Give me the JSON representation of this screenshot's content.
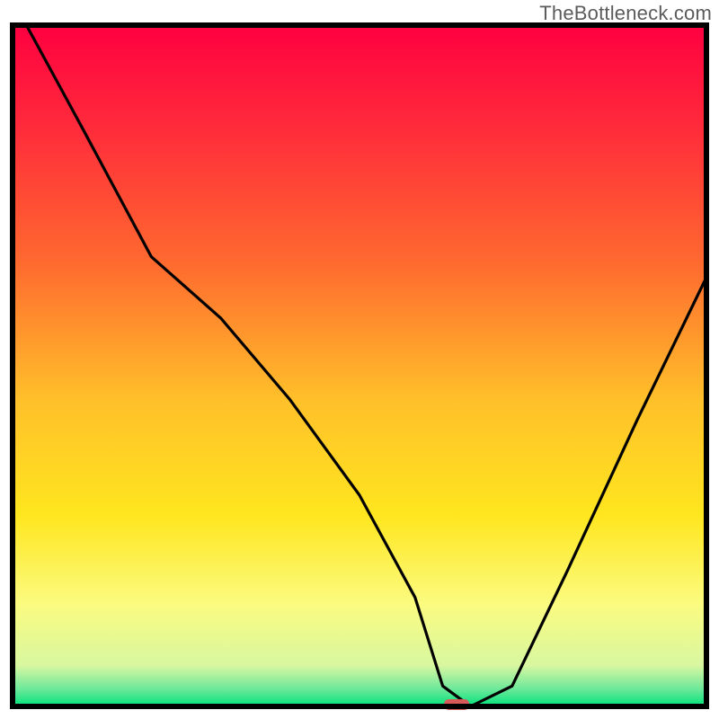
{
  "watermark": "TheBottleneck.com",
  "chart_data": {
    "type": "line",
    "title": "",
    "xlabel": "",
    "ylabel": "",
    "xlim": [
      0,
      100
    ],
    "ylim": [
      0,
      100
    ],
    "curve": {
      "name": "bottleneck-curve",
      "x": [
        2,
        10,
        20,
        30,
        40,
        50,
        58,
        62,
        66,
        72,
        80,
        90,
        100
      ],
      "y": [
        100,
        85,
        66,
        57,
        45,
        31,
        16,
        3,
        0,
        3,
        20,
        42,
        63
      ]
    },
    "marker": {
      "x": 64,
      "y": 0,
      "color": "#d65a5a"
    },
    "gradient_stops": [
      {
        "offset": 0.0,
        "color": "#ff0040"
      },
      {
        "offset": 0.15,
        "color": "#ff2b3b"
      },
      {
        "offset": 0.35,
        "color": "#ff6a2f"
      },
      {
        "offset": 0.55,
        "color": "#ffc02a"
      },
      {
        "offset": 0.72,
        "color": "#ffe61f"
      },
      {
        "offset": 0.85,
        "color": "#fbfb80"
      },
      {
        "offset": 0.94,
        "color": "#d8f7a0"
      },
      {
        "offset": 0.975,
        "color": "#6be89a"
      },
      {
        "offset": 1.0,
        "color": "#00e27a"
      }
    ],
    "border_color": "#000000",
    "curve_color": "#000000"
  }
}
